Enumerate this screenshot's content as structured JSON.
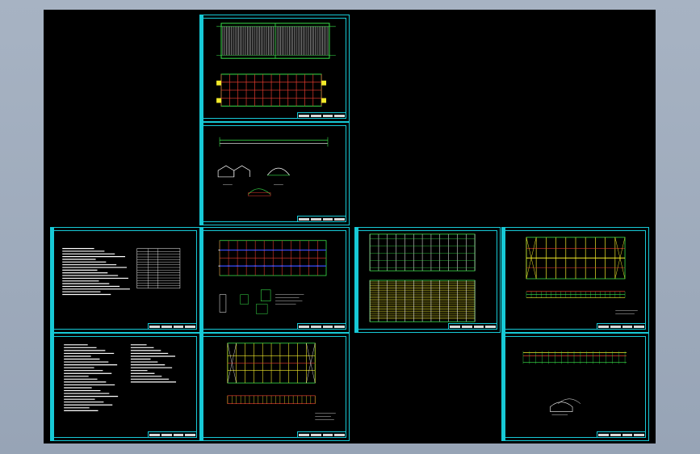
{
  "viewport": {
    "background": "#000000",
    "frame_color": "#17c9d6",
    "line_colors": {
      "green": "#39e34a",
      "red": "#e23b2e",
      "yellow": "#f2ea2a",
      "white": "#ffffff",
      "blue": "#3a4bff",
      "cyan": "#17c9d6"
    }
  },
  "sheets": [
    {
      "id": "s1",
      "content": "roof-plan-and-column-grid"
    },
    {
      "id": "s2",
      "content": "elevations-and-sections"
    },
    {
      "id": "s3",
      "content": "design-notes-and-table"
    },
    {
      "id": "s4",
      "content": "foundation-plan-and-details"
    },
    {
      "id": "s5",
      "content": "purlin-layout-plans"
    },
    {
      "id": "s6",
      "content": "bracing-plan-and-elevation"
    },
    {
      "id": "s7",
      "content": "general-notes-text"
    },
    {
      "id": "s8",
      "content": "wall-bracing-plan"
    },
    {
      "id": "s9",
      "content": "side-elevation-and-3d-view"
    }
  ]
}
